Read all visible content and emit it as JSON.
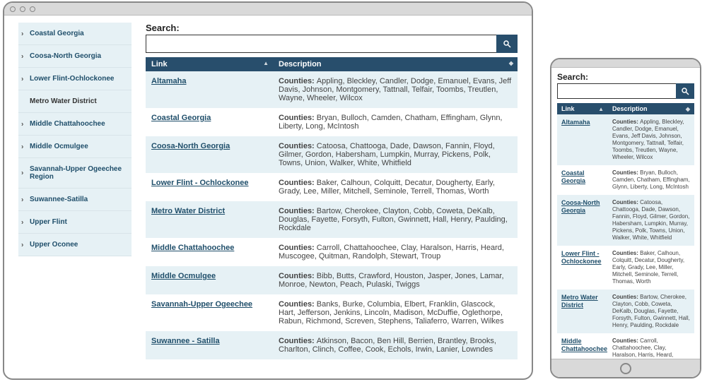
{
  "search_label": "Search:",
  "search_placeholder": "",
  "table": {
    "col_link": "Link",
    "col_desc": "Description",
    "desc_prefix": "Counties:"
  },
  "sidebar": {
    "items": [
      {
        "label": "Coastal Georgia",
        "selected": false
      },
      {
        "label": "Coosa-North Georgia",
        "selected": false
      },
      {
        "label": "Lower Flint-Ochlockonee",
        "selected": false
      },
      {
        "label": "Metro Water District",
        "selected": true
      },
      {
        "label": "Middle Chattahoochee",
        "selected": false
      },
      {
        "label": "Middle Ocmulgee",
        "selected": false
      },
      {
        "label": "Savannah-Upper Ogeechee Region",
        "selected": false
      },
      {
        "label": "Suwannee-Satilla",
        "selected": false
      },
      {
        "label": "Upper Flint",
        "selected": false
      },
      {
        "label": "Upper Oconee",
        "selected": false
      }
    ]
  },
  "rows_desktop": [
    {
      "link": "Altamaha",
      "desc": "Appling, Bleckley, Candler, Dodge, Emanuel, Evans, Jeff Davis, Johnson, Montgomery, Tattnall, Telfair, Toombs, Treutlen, Wayne, Wheeler, Wilcox"
    },
    {
      "link": "Coastal Georgia",
      "desc": "Bryan, Bulloch, Camden, Chatham, Effingham, Glynn, Liberty, Long, McIntosh"
    },
    {
      "link": "Coosa-North Georgia",
      "desc": "Catoosa, Chattooga, Dade, Dawson, Fannin, Floyd, Gilmer, Gordon, Habersham, Lumpkin, Murray, Pickens, Polk, Towns, Union, Walker, White, Whitfield"
    },
    {
      "link": "Lower Flint - Ochlockonee",
      "desc": "Baker, Calhoun, Colquitt, Decatur, Dougherty, Early, Grady, Lee, Miller, Mitchell, Seminole, Terrell, Thomas, Worth"
    },
    {
      "link": "Metro Water District",
      "desc": "Bartow, Cherokee, Clayton, Cobb, Coweta, DeKalb, Douglas, Fayette, Forsyth, Fulton, Gwinnett, Hall, Henry, Paulding, Rockdale"
    },
    {
      "link": "Middle Chattahoochee",
      "desc": "Carroll, Chattahoochee, Clay, Haralson, Harris, Heard, Muscogee, Quitman, Randolph, Stewart, Troup"
    },
    {
      "link": "Middle Ocmulgee",
      "desc": "Bibb, Butts, Crawford, Houston, Jasper, Jones, Lamar, Monroe, Newton, Peach, Pulaski, Twiggs"
    },
    {
      "link": "Savannah-Upper Ogeechee",
      "desc": "Banks, Burke, Columbia, Elbert, Franklin, Glascock, Hart, Jefferson, Jenkins, Lincoln, Madison, McDuffie, Oglethorpe, Rabun, Richmond, Screven, Stephens, Taliaferro, Warren, Wilkes"
    },
    {
      "link": "Suwannee - Satilla",
      "desc": "Atkinson, Bacon, Ben Hill, Berrien, Brantley, Brooks, Charlton, Clinch, Coffee, Cook, Echols, Irwin, Lanier, Lowndes"
    }
  ],
  "rows_mobile": [
    {
      "link": "Altamaha",
      "desc": "Appling, Bleckley, Candler, Dodge, Emanuel, Evans, Jeff Davis, Johnson, Montgomery, Tattnall, Telfair, Toombs, Treutlen, Wayne, Wheeler, Wilcox"
    },
    {
      "link": "Coastal Georgia",
      "desc": "Bryan, Bulloch, Camden, Chatham, Effingham, Glynn, Liberty, Long, McIntosh"
    },
    {
      "link": "Coosa-North Georgia",
      "desc": "Catoosa, Chattooga, Dade, Dawson, Fannin, Floyd, Gilmer, Gordon, Habersham, Lumpkin, Murray, Pickens, Polk, Towns, Union, Walker, White, Whitfield"
    },
    {
      "link": "Lower Flint - Ochlockonee",
      "desc": "Baker, Calhoun, Colquitt, Decatur, Dougherty, Early, Grady, Lee, Miller, Mitchell, Seminole, Terrell, Thomas, Worth"
    },
    {
      "link": "Metro Water District",
      "desc": "Bartow, Cherokee, Clayton, Cobb, Coweta, DeKalb, Douglas, Fayette, Forsyth, Fulton, Gwinnett, Hall, Henry, Paulding, Rockdale"
    },
    {
      "link": "Middle Chattahoochee",
      "desc": "Carroll, Chattahoochee, Clay, Haralson, Harris, Heard, Muscogee, Quitman, Randolph,"
    }
  ]
}
